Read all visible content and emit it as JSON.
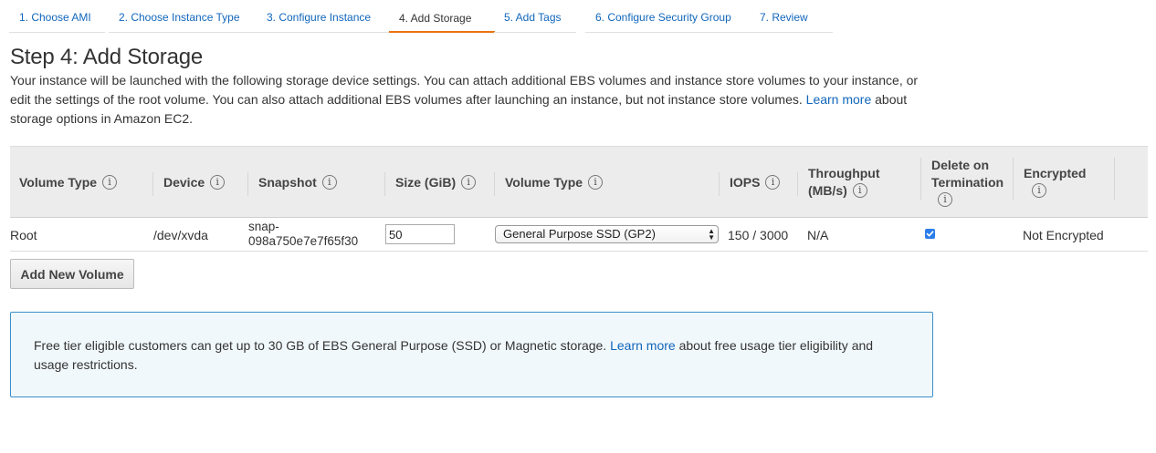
{
  "wizard": {
    "tabs": [
      {
        "label": "1. Choose AMI"
      },
      {
        "label": "2. Choose Instance Type"
      },
      {
        "label": "3. Configure Instance"
      },
      {
        "label": "4. Add Storage"
      },
      {
        "label": "5. Add Tags"
      },
      {
        "label": "6. Configure Security Group"
      },
      {
        "label": "7. Review"
      }
    ],
    "active_tab": "4. Add Storage"
  },
  "page": {
    "title": "Step 4: Add Storage",
    "description_before_link": "Your instance will be launched with the following storage device settings. You can attach additional EBS volumes and instance store volumes to your instance, or edit the settings of the root volume. You can also attach additional EBS volumes after launching an instance, but not instance store volumes.",
    "learn_more_label": "Learn more",
    "description_after_link": "about storage options in Amazon EC2."
  },
  "table": {
    "headers": {
      "volume_type": "Volume Type",
      "device": "Device",
      "snapshot": "Snapshot",
      "size": "Size (GiB)",
      "volume_type_2": "Volume Type",
      "iops": "IOPS",
      "throughput_line1": "Throughput",
      "throughput_line2": "(MB/s)",
      "delete_line1": "Delete on",
      "delete_line2": "Termination",
      "encrypted": "Encrypted"
    },
    "info_icon_glyph": "i",
    "rows": [
      {
        "volume_type": "Root",
        "device": "/dev/xvda",
        "snapshot_line1": "snap-",
        "snapshot_line2": "098a750e7e7f65f30",
        "size": "50",
        "volume_type_select": "General Purpose SSD (GP2)",
        "iops": "150 / 3000",
        "throughput": "N/A",
        "delete_on_termination": true,
        "encrypted": "Not Encrypted"
      }
    ]
  },
  "actions": {
    "add_volume_label": "Add New Volume"
  },
  "free_tier": {
    "text_before_link": "Free tier eligible customers can get up to 30 GB of EBS General Purpose (SSD) or Magnetic storage.",
    "learn_more_label": "Learn more",
    "text_after_link": "about free usage tier eligibility and usage restrictions."
  },
  "colors": {
    "link": "#1166bb",
    "active_tab_underline": "#ec7211",
    "info_box_border": "#3b8ec9",
    "info_box_bg": "#f1f8fc",
    "checkbox": "#2b7de9"
  },
  "icons": {
    "info": "info-circle-icon",
    "checkmark": "checkmark-icon",
    "select_arrows": "updown-arrows-icon"
  }
}
